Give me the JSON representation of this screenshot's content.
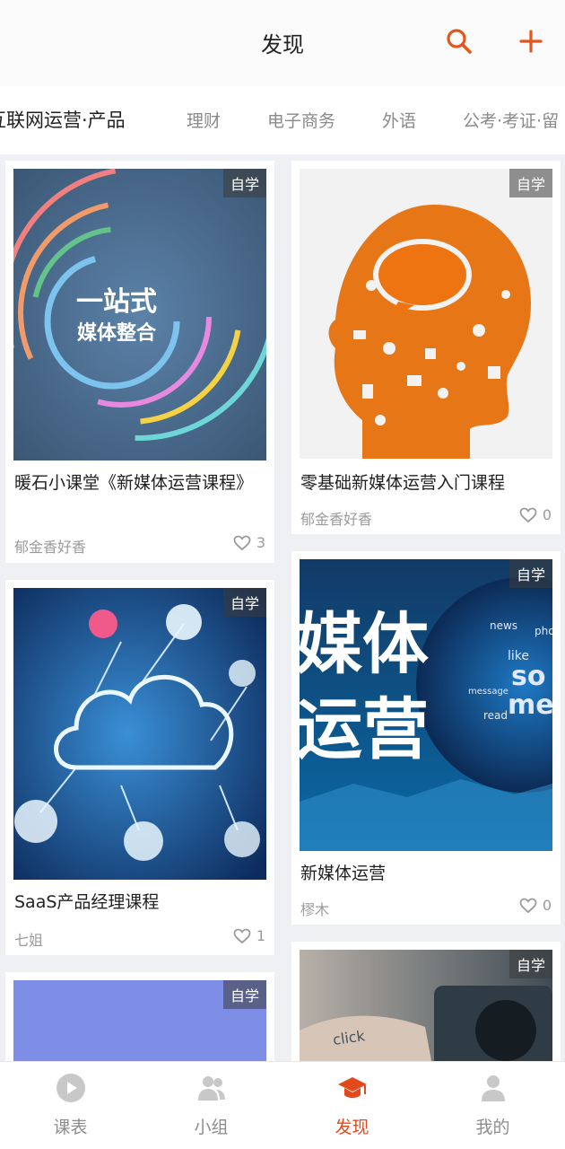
{
  "header": {
    "title": "发现"
  },
  "categories": [
    {
      "label": "互联网运营·产品"
    },
    {
      "label": "理财"
    },
    {
      "label": "电子商务"
    },
    {
      "label": "外语"
    },
    {
      "label": "公考·考证·留"
    }
  ],
  "cards": [
    {
      "badge": "自学",
      "title": "暖石小课堂《新媒体运营课程》",
      "author": "郁金香好香",
      "likes": "3",
      "image_text": {
        "main": "一站式",
        "sub": "媒体整合"
      }
    },
    {
      "badge": "自学",
      "title": "零基础新媒体运营入门课程",
      "author": "郁金香好香",
      "likes": "0"
    },
    {
      "badge": "自学",
      "title": "SaaS产品经理课程",
      "author": "七姐",
      "likes": "1"
    },
    {
      "badge": "自学",
      "title": "新媒体运营",
      "author": "樛木",
      "likes": "0",
      "image_text": {
        "line1": "媒体",
        "line2": "运营",
        "words": [
          "news",
          "like",
          "so",
          "me",
          "phone",
          "message",
          "read"
        ]
      }
    },
    {
      "badge": "自学"
    },
    {
      "badge": "自学",
      "image_text": {
        "word": "click"
      }
    }
  ],
  "tabs": [
    {
      "label": "课表",
      "icon": "play-icon"
    },
    {
      "label": "小组",
      "icon": "group-icon"
    },
    {
      "label": "发现",
      "icon": "graduation-cap-icon"
    },
    {
      "label": "我的",
      "icon": "person-icon"
    }
  ],
  "colors": {
    "accent": "#e24a1d",
    "muted": "#9b9b9b"
  }
}
